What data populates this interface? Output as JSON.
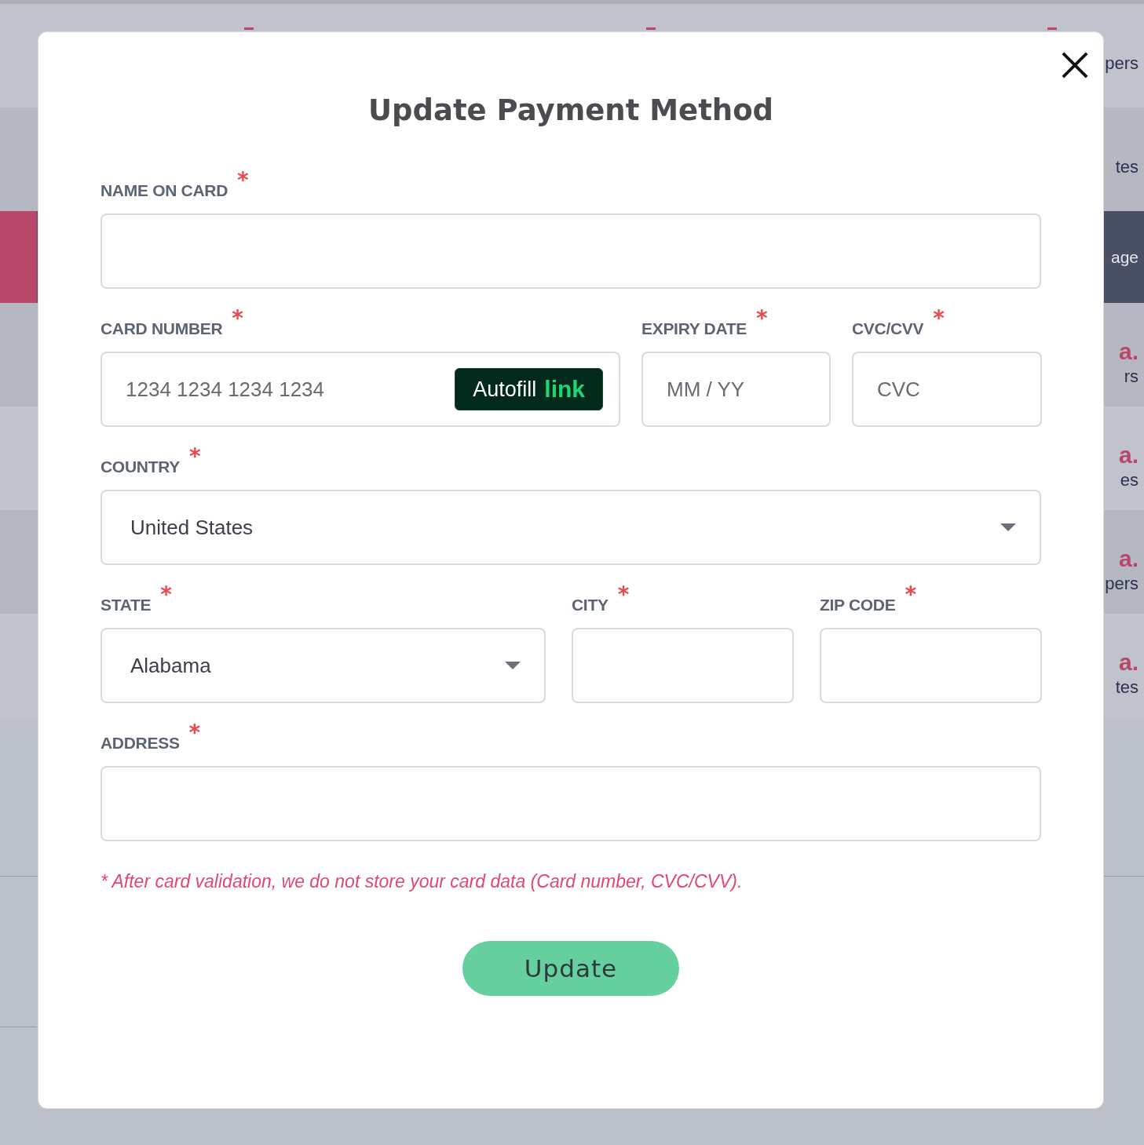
{
  "background": {
    "rows": [
      {
        "text": "pers",
        "selected": false
      },
      {
        "text": "tes",
        "selected": false
      },
      {
        "text": "age",
        "selected": true
      },
      {
        "mark": "a.",
        "text": "rs",
        "selected": false
      },
      {
        "mark": "a.",
        "text": "es",
        "selected": false
      },
      {
        "mark": "a.",
        "text": "pers",
        "selected": false
      },
      {
        "mark": "a.",
        "text": "tes",
        "selected": false
      }
    ]
  },
  "dialog": {
    "title": "Update Payment Method",
    "required_mark": "*",
    "rows": [
      [
        {
          "kind": "text",
          "label": "NAME ON CARD",
          "required": true
        }
      ],
      [
        {
          "kind": "card",
          "label": "CARD NUMBER",
          "required": true,
          "placeholder": "1234 1234 1234 1234",
          "autofill": {
            "label": "Autofill",
            "brand": "link"
          }
        },
        {
          "kind": "text",
          "label": "EXPIRY DATE",
          "required": true,
          "placeholder": "MM / YY"
        },
        {
          "kind": "text",
          "label": "CVC/CVV",
          "required": true,
          "placeholder": "CVC"
        }
      ],
      [
        {
          "kind": "select",
          "label": "COUNTRY",
          "required": true,
          "value": "United States"
        }
      ],
      [
        {
          "kind": "select",
          "label": "STATE",
          "required": true,
          "value": "Alabama"
        },
        {
          "kind": "text",
          "label": "CITY",
          "required": true
        },
        {
          "kind": "text",
          "label": "ZIP CODE",
          "required": true
        }
      ],
      [
        {
          "kind": "text",
          "label": "ADDRESS",
          "required": true
        }
      ]
    ],
    "note": "* After card validation, we do not store your card data (Card number, CVC/CVV).",
    "submit": "Update"
  }
}
